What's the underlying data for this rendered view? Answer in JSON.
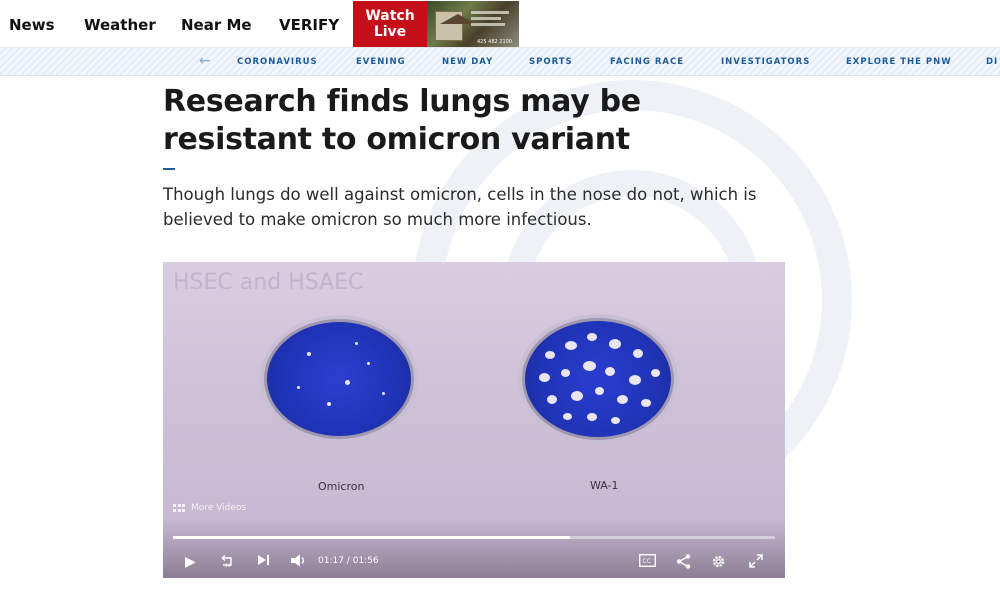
{
  "topnav": {
    "items": [
      "News",
      "Weather",
      "Near Me",
      "VERIFY"
    ],
    "watch_live": "Watch Live",
    "ad_phone": "425 482 2100"
  },
  "subnav": {
    "items": [
      "CORONAVIRUS",
      "EVENING",
      "NEW DAY",
      "SPORTS",
      "FACING RACE",
      "INVESTIGATORS",
      "EXPLORE THE PNW",
      "DI"
    ]
  },
  "article": {
    "headline": "Research finds lungs may be resistant to omicron variant",
    "dek": "Though lungs do well against omicron, cells in the nose do not, which is believed to make omicron so much more infectious."
  },
  "video": {
    "faded_caption": "HSEC and HSAEC",
    "dish_left_label": "Omicron",
    "dish_right_label": "WA-1",
    "more_videos": "More Videos",
    "time": "01:17 / 01:56",
    "progress": 0.66
  },
  "colors": {
    "brand_red": "#c40f1a",
    "section_blue": "#1e5b9a"
  },
  "icons": [
    "arrow-left-icon",
    "play-icon",
    "replay-10-icon",
    "next-icon",
    "volume-icon",
    "cc-icon",
    "share-icon",
    "settings-icon",
    "fullscreen-icon",
    "grid-icon"
  ]
}
